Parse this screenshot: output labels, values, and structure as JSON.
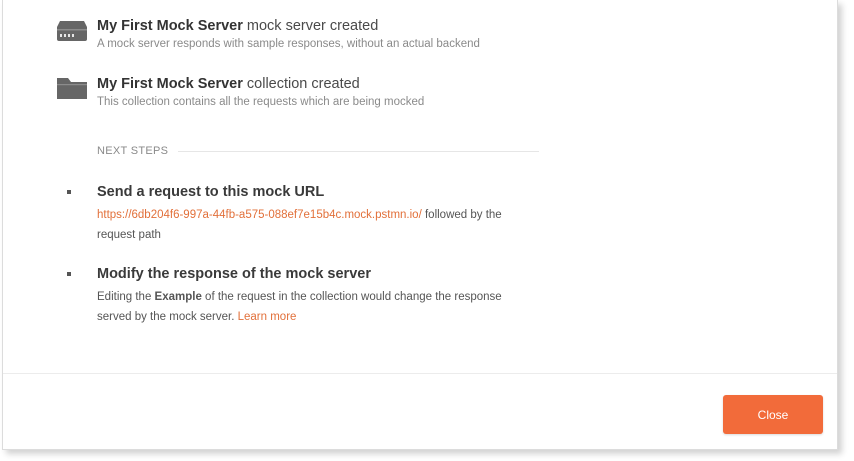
{
  "items": [
    {
      "icon": "server-icon",
      "name_bold": "My First Mock Server",
      "name_rest": " mock server created",
      "description": "A mock server responds with sample responses, without an actual backend"
    },
    {
      "icon": "folder-icon",
      "name_bold": "My First Mock Server",
      "name_rest": " collection created",
      "description": "This collection contains all the requests which are being mocked"
    }
  ],
  "next_steps": {
    "label": "NEXT STEPS",
    "steps": [
      {
        "title": "Send a request to this mock URL",
        "url": "https://6db204f6-997a-44fb-a575-088ef7e15b4c.mock.pstmn.io/",
        "text_after_url": " followed by the request path"
      },
      {
        "title": "Modify the response of the mock server",
        "text_before": "Editing the ",
        "text_bold": "Example",
        "text_after": " of the request in the collection would change the response served by the mock server. ",
        "link": "Learn more"
      }
    ]
  },
  "footer": {
    "close_label": "Close"
  },
  "colors": {
    "accent": "#f26b3a",
    "link": "#e2703a"
  }
}
